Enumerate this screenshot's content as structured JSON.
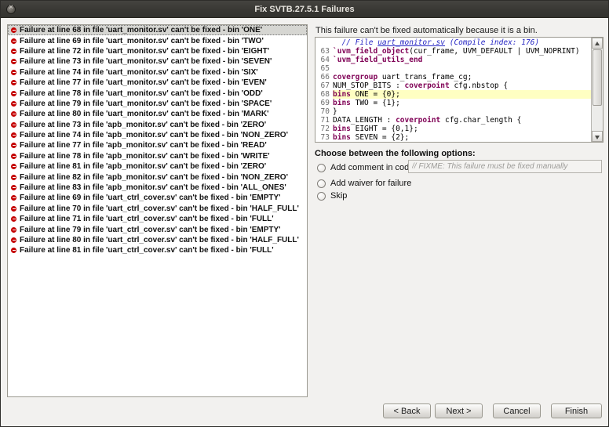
{
  "window": {
    "title": "Fix SVTB.27.5.1 Failures"
  },
  "colors": {
    "titlebar": "#454440",
    "error": "#c40000",
    "keyword": "#7f0055",
    "comment": "#2626c4",
    "line-highlight": "#ffffc2",
    "selection": "#d6d6d2"
  },
  "failure_list": [
    {
      "text": "Failure at line 68 in file 'uart_monitor.sv' can't be fixed - bin 'ONE'",
      "selected": true
    },
    {
      "text": "Failure at line 69 in file 'uart_monitor.sv' can't be fixed - bin 'TWO'",
      "selected": false
    },
    {
      "text": "Failure at line 72 in file 'uart_monitor.sv' can't be fixed - bin 'EIGHT'",
      "selected": false
    },
    {
      "text": "Failure at line 73 in file 'uart_monitor.sv' can't be fixed - bin 'SEVEN'",
      "selected": false
    },
    {
      "text": "Failure at line 74 in file 'uart_monitor.sv' can't be fixed - bin 'SIX'",
      "selected": false
    },
    {
      "text": "Failure at line 77 in file 'uart_monitor.sv' can't be fixed - bin 'EVEN'",
      "selected": false
    },
    {
      "text": "Failure at line 78 in file 'uart_monitor.sv' can't be fixed - bin 'ODD'",
      "selected": false
    },
    {
      "text": "Failure at line 79 in file 'uart_monitor.sv' can't be fixed - bin 'SPACE'",
      "selected": false
    },
    {
      "text": "Failure at line 80 in file 'uart_monitor.sv' can't be fixed - bin 'MARK'",
      "selected": false
    },
    {
      "text": "Failure at line 73 in file 'apb_monitor.sv' can't be fixed - bin 'ZERO'",
      "selected": false
    },
    {
      "text": "Failure at line 74 in file 'apb_monitor.sv' can't be fixed - bin 'NON_ZERO'",
      "selected": false
    },
    {
      "text": "Failure at line 77 in file 'apb_monitor.sv' can't be fixed - bin 'READ'",
      "selected": false
    },
    {
      "text": "Failure at line 78 in file 'apb_monitor.sv' can't be fixed - bin 'WRITE'",
      "selected": false
    },
    {
      "text": "Failure at line 81 in file 'apb_monitor.sv' can't be fixed - bin 'ZERO'",
      "selected": false
    },
    {
      "text": "Failure at line 82 in file 'apb_monitor.sv' can't be fixed - bin 'NON_ZERO'",
      "selected": false
    },
    {
      "text": "Failure at line 83 in file 'apb_monitor.sv' can't be fixed - bin 'ALL_ONES'",
      "selected": false
    },
    {
      "text": "Failure at line 69 in file 'uart_ctrl_cover.sv' can't be fixed - bin 'EMPTY'",
      "selected": false
    },
    {
      "text": "Failure at line 70 in file 'uart_ctrl_cover.sv' can't be fixed - bin 'HALF_FULL'",
      "selected": false
    },
    {
      "text": "Failure at line 71 in file 'uart_ctrl_cover.sv' can't be fixed - bin 'FULL'",
      "selected": false
    },
    {
      "text": "Failure at line 79 in file 'uart_ctrl_cover.sv' can't be fixed - bin 'EMPTY'",
      "selected": false
    },
    {
      "text": "Failure at line 80 in file 'uart_ctrl_cover.sv' can't be fixed - bin 'HALF_FULL'",
      "selected": false
    },
    {
      "text": "Failure at line 81 in file 'uart_ctrl_cover.sv' can't be fixed - bin 'FULL'",
      "selected": false
    }
  ],
  "detail": {
    "message": "This failure can't be fixed automatically because it is a bin."
  },
  "code": {
    "lines": [
      {
        "num": "",
        "highlight": false,
        "tokens": [
          {
            "t": "comment",
            "c": "  // File "
          },
          {
            "t": "link",
            "c": "uart_monitor.sv"
          },
          {
            "t": "comment",
            "c": " (Compile index: 176)"
          }
        ]
      },
      {
        "num": "63",
        "highlight": false,
        "tokens": [
          {
            "t": "kw",
            "c": "`uvm_field_object"
          },
          {
            "t": "plain",
            "c": "(cur_frame, UVM_DEFAULT | UVM_NOPRINT)"
          }
        ]
      },
      {
        "num": "64",
        "highlight": false,
        "tokens": [
          {
            "t": "kw",
            "c": "`uvm_field_utils_end"
          }
        ]
      },
      {
        "num": "65",
        "highlight": false,
        "tokens": []
      },
      {
        "num": "66",
        "highlight": false,
        "tokens": [
          {
            "t": "kw",
            "c": "covergroup"
          },
          {
            "t": "plain",
            "c": " uart_trans_frame_cg;"
          }
        ]
      },
      {
        "num": "67",
        "highlight": false,
        "tokens": [
          {
            "t": "plain",
            "c": "NUM_STOP_BITS : "
          },
          {
            "t": "kw",
            "c": "coverpoint"
          },
          {
            "t": "plain",
            "c": " cfg.nbstop {"
          }
        ]
      },
      {
        "num": "68",
        "highlight": true,
        "tokens": [
          {
            "t": "kw",
            "c": "bins"
          },
          {
            "t": "plain",
            "c": " ONE = {0};"
          }
        ]
      },
      {
        "num": "69",
        "highlight": false,
        "tokens": [
          {
            "t": "kw",
            "c": "bins"
          },
          {
            "t": "plain",
            "c": " TWO = {1};"
          }
        ]
      },
      {
        "num": "70",
        "highlight": false,
        "tokens": [
          {
            "t": "plain",
            "c": "}"
          }
        ]
      },
      {
        "num": "71",
        "highlight": false,
        "tokens": [
          {
            "t": "plain",
            "c": "DATA_LENGTH : "
          },
          {
            "t": "kw",
            "c": "coverpoint"
          },
          {
            "t": "plain",
            "c": " cfg.char_length {"
          }
        ]
      },
      {
        "num": "72",
        "highlight": false,
        "tokens": [
          {
            "t": "kw",
            "c": "bins"
          },
          {
            "t": "plain",
            "c": " EIGHT = {0,1};"
          }
        ]
      },
      {
        "num": "73",
        "highlight": false,
        "tokens": [
          {
            "t": "kw",
            "c": "bins"
          },
          {
            "t": "plain",
            "c": " SEVEN = {2};"
          }
        ]
      }
    ]
  },
  "options": {
    "label": "Choose between the following options:",
    "add_comment": "Add comment in code",
    "add_comment_value": "// FIXME: This failure must be fixed manually",
    "add_waiver": "Add waiver for failure",
    "skip": "Skip"
  },
  "buttons": {
    "back": "< Back",
    "next": "Next >",
    "cancel": "Cancel",
    "finish": "Finish"
  }
}
